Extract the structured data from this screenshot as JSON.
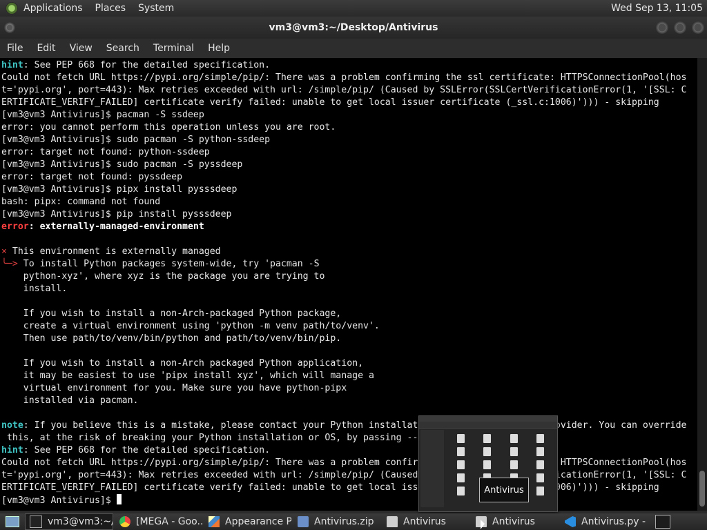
{
  "top_panel": {
    "menus": [
      "Applications",
      "Places",
      "System"
    ],
    "clock": "Wed Sep 13, 11:05"
  },
  "window": {
    "title": "vm3@vm3:~/Desktop/Antivirus"
  },
  "menubar": [
    "File",
    "Edit",
    "View",
    "Search",
    "Terminal",
    "Help"
  ],
  "terminal": {
    "lines": [
      [
        {
          "c": "cyan",
          "t": "hint"
        },
        {
          "t": ": See PEP 668 for the detailed specification."
        }
      ],
      [
        {
          "t": "Could not fetch URL https://pypi.org/simple/pip/: There was a problem confirming the ssl certificate: HTTPSConnectionPool(hos"
        }
      ],
      [
        {
          "t": "t='pypi.org', port=443): Max retries exceeded with url: /simple/pip/ (Caused by SSLError(SSLCertVerificationError(1, '[SSL: C"
        }
      ],
      [
        {
          "t": "ERTIFICATE_VERIFY_FAILED] certificate verify failed: unable to get local issuer certificate (_ssl.c:1006)'))) - skipping"
        }
      ],
      [
        {
          "t": "[vm3@vm3 Antivirus]$ pacman -S ssdeep"
        }
      ],
      [
        {
          "t": "error: you cannot perform this operation unless you are root."
        }
      ],
      [
        {
          "t": "[vm3@vm3 Antivirus]$ sudo pacman -S python-ssdeep"
        }
      ],
      [
        {
          "t": "error: target not found: python-ssdeep"
        }
      ],
      [
        {
          "t": "[vm3@vm3 Antivirus]$ sudo pacman -S pyssdeep"
        }
      ],
      [
        {
          "t": "error: target not found: pyssdeep"
        }
      ],
      [
        {
          "t": "[vm3@vm3 Antivirus]$ pipx install pysssdeep"
        }
      ],
      [
        {
          "t": "bash: pipx: command not found"
        }
      ],
      [
        {
          "t": "[vm3@vm3 Antivirus]$ pip install pysssdeep"
        }
      ],
      [
        {
          "c": "red",
          "t": "error"
        },
        {
          "c": "bold",
          "t": ": externally-managed-environment"
        }
      ],
      [
        {
          "t": ""
        }
      ],
      [
        {
          "c": "redthin",
          "t": "×"
        },
        {
          "t": " This environment is externally managed"
        }
      ],
      [
        {
          "c": "redthin",
          "t": "╰─>"
        },
        {
          "t": " To install Python packages system-wide, try 'pacman -S"
        }
      ],
      [
        {
          "t": "    python-xyz', where xyz is the package you are trying to"
        }
      ],
      [
        {
          "t": "    install."
        }
      ],
      [
        {
          "t": ""
        }
      ],
      [
        {
          "t": "    If you wish to install a non-Arch-packaged Python package,"
        }
      ],
      [
        {
          "t": "    create a virtual environment using 'python -m venv path/to/venv'."
        }
      ],
      [
        {
          "t": "    Then use path/to/venv/bin/python and path/to/venv/bin/pip."
        }
      ],
      [
        {
          "t": ""
        }
      ],
      [
        {
          "t": "    If you wish to install a non-Arch packaged Python application,"
        }
      ],
      [
        {
          "t": "    it may be easiest to use 'pipx install xyz', which will manage a"
        }
      ],
      [
        {
          "t": "    virtual environment for you. Make sure you have python-pipx"
        }
      ],
      [
        {
          "t": "    installed via pacman."
        }
      ],
      [
        {
          "t": ""
        }
      ],
      [
        {
          "c": "cyan",
          "t": "note"
        },
        {
          "t": ": If you believe this is a mistake, please contact your Python installation or OS distribution provider. You can override"
        }
      ],
      [
        {
          "t": " this, at the risk of breaking your Python installation or OS, by passing --break-system-packages."
        }
      ],
      [
        {
          "c": "cyan",
          "t": "hint"
        },
        {
          "t": ": See PEP 668 for the detailed specification."
        }
      ],
      [
        {
          "t": "Could not fetch URL https://pypi.org/simple/pip/: There was a problem confirming the ssl certificate: HTTPSConnectionPool(hos"
        }
      ],
      [
        {
          "t": "t='pypi.org', port=443): Max retries exceeded with url: /simple/pip/ (Caused by SSLError(SSLCertVerificationError(1, '[SSL: C"
        }
      ],
      [
        {
          "t": "ERTIFICATE_VERIFY_FAILED] certificate verify failed: unable to get local issuer certificate (_ssl.c:1006)'))) - skipping"
        }
      ],
      [
        {
          "t": "[vm3@vm3 Antivirus]$ "
        }
      ]
    ]
  },
  "tooltip": "Antivirus",
  "taskbar": {
    "items": [
      {
        "label": "vm3@vm3:~/...",
        "icon": "terminal-icon",
        "active": true
      },
      {
        "label": "[MEGA - Goo...",
        "icon": "chrome-icon",
        "active": false
      },
      {
        "label": "Appearance P...",
        "icon": "appearance-icon",
        "active": false
      },
      {
        "label": "Antivirus.zip",
        "icon": "archive-icon",
        "active": false
      },
      {
        "label": "Antivirus",
        "icon": "folder-icon",
        "active": false
      },
      {
        "label": "Antivirus",
        "icon": "folder-icon",
        "active": false
      },
      {
        "label": "Antivirus.py - ...",
        "icon": "vscode-icon",
        "active": false
      }
    ]
  },
  "colors": {
    "hint_cyan": "#41c6c6",
    "error_red": "#ff4040",
    "terminal_bg": "#000000"
  }
}
